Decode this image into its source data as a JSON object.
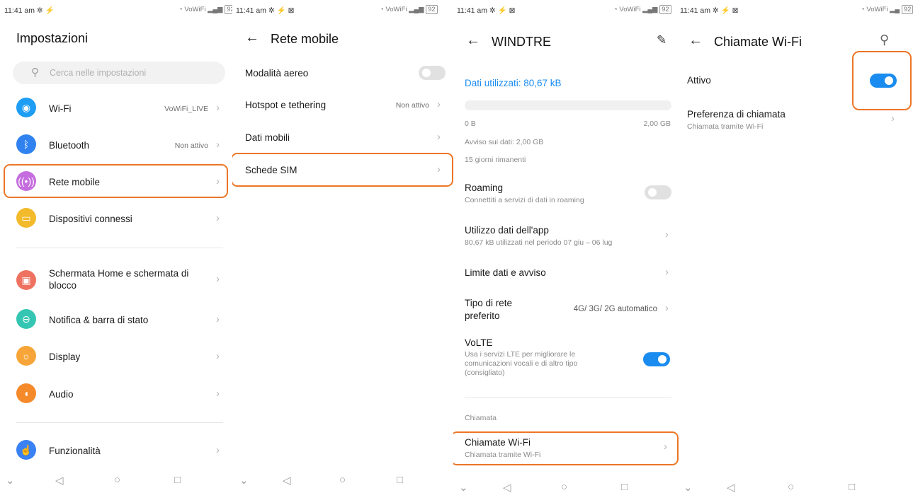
{
  "colors": {
    "accent": "#1a8cf0",
    "highlight": "#ec7627",
    "icon_wifi": "#1e9df5",
    "icon_bluetooth": "#2f82ef",
    "icon_mobile": "#c56dde",
    "icon_devices": "#f3ba2b",
    "icon_home": "#ef7261",
    "icon_notify": "#34c6b2",
    "icon_display": "#f7a538",
    "icon_audio": "#f58a2b",
    "icon_features": "#3a82f3"
  },
  "status_bar": {
    "time_1": "11:41 am",
    "time_2": "11:41 am",
    "time_3": "11:41 am",
    "time_4": "11:41 am",
    "network": "VoWiFi",
    "battery": "92"
  },
  "screen1": {
    "title": "Impostazioni",
    "search_placeholder": "Cerca nelle impostazioni",
    "items": [
      {
        "label": "Wi-Fi",
        "value": "VoWiFi_LIVE",
        "icon": "wifi-icon"
      },
      {
        "label": "Bluetooth",
        "value": "Non attivo",
        "icon": "bluetooth-icon"
      },
      {
        "label": "Rete mobile",
        "value": "",
        "icon": "mobile-network-icon"
      },
      {
        "label": "Dispositivi connessi",
        "value": "",
        "icon": "connected-devices-icon"
      },
      {
        "label_line1": "Schermata Home e schermata di",
        "label_line2": "blocco",
        "icon": "home-screen-icon"
      },
      {
        "label": "Notifica & barra di stato",
        "icon": "notification-icon"
      },
      {
        "label": "Display",
        "icon": "display-icon"
      },
      {
        "label": "Audio",
        "icon": "audio-icon"
      },
      {
        "label": "Funzionalità",
        "icon": "features-icon"
      }
    ]
  },
  "screen2": {
    "title": "Rete mobile",
    "items": [
      {
        "label": "Modalità aereo",
        "toggle": false
      },
      {
        "label": "Hotspot e tethering",
        "value": "Non attivo"
      },
      {
        "label": "Dati mobili"
      },
      {
        "label": "Schede SIM"
      }
    ]
  },
  "screen3": {
    "title": "WINDTRE",
    "data_used": "Dati utilizzati: 80,67 kB",
    "data_used_progress": 0.0,
    "range_min": "0 B",
    "range_max": "2,00 GB",
    "warning": "Avviso sui dati: 2,00 GB",
    "days_left": "15 giorni rimanenti",
    "roaming": {
      "label": "Roaming",
      "sub": "Connettiti a servizi di dati in roaming",
      "toggle": false
    },
    "app_usage": {
      "label": "Utilizzo dati dell'app",
      "sub": "80,67 kB utilizzati nel periodo 07 giu – 06 lug"
    },
    "limit": {
      "label": "Limite dati e avviso"
    },
    "network_type": {
      "label_line1": "Tipo di rete",
      "label_line2": "preferito",
      "value": "4G/ 3G/ 2G automatico"
    },
    "volte": {
      "label": "VoLTE",
      "sub_line1": "Usa i servizi LTE per migliorare le",
      "sub_line2": "comunicazioni vocali e di altro tipo",
      "sub_line3": "(consigliato)",
      "toggle": true
    },
    "section_call": "Chiamata",
    "wifi_calling": {
      "label": "Chiamate Wi-Fi",
      "sub": "Chiamata tramite Wi-Fi"
    }
  },
  "screen4": {
    "title": "Chiamate Wi-Fi",
    "active": {
      "label": "Attivo",
      "toggle": true
    },
    "preference": {
      "label": "Preferenza di chiamata",
      "sub": "Chiamata tramite Wi-Fi"
    }
  }
}
